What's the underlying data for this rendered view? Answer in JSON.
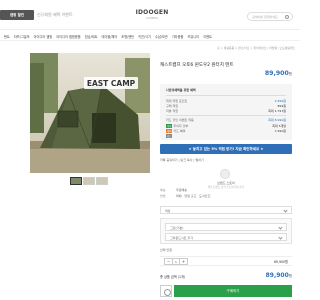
{
  "header": {
    "badge_text": "캠핑 할인",
    "promo_text": "신규회원 혜택 이벤트",
    "brand": "IDOOGEN",
    "brand_sub": "CAMPING",
    "search_placeholder": "검색어를 입력하세요"
  },
  "nav": {
    "items": [
      "텐트",
      "타프/그늘막",
      "아이디어 캠핑",
      "아이디어 캠핑용품",
      "침낭/매트",
      "테이블/체어",
      "조명/랜턴",
      "키친/식기",
      "수납/보관",
      "기타용품",
      "커뮤니티",
      "이벤트"
    ]
  },
  "breadcrumb": "홈  >  캠핑용품  >  텐트/타프  >  원터치텐트 / 리빙쉘 / 오토캠핑텐트",
  "product": {
    "image_label": "EAST CAMP",
    "title": "캐스트캠프 오토6 윈도우2 원터치 텐트",
    "price": "89,900",
    "price_unit": "원"
  },
  "benefits": {
    "heading": "나만의혜택을 위한 혜택",
    "rows": [
      {
        "label": "최대 적립 포인트",
        "value": "2,696원"
      },
      {
        "label": "구매 적립",
        "value": "899원"
      },
      {
        "label": "리뷰 적립",
        "value": "최대 1,797원"
      },
      {
        "label": "카드 할인 이벤트 적용",
        "value": "최대 8,990원"
      },
      {
        "label": "무이자 할부",
        "value": "최대 5개월"
      },
      {
        "label": "카드 혜택",
        "value": "7,990원"
      }
    ],
    "tags": [
      "추가",
      "혜택",
      "카드"
    ]
  },
  "banner": "★ 놓치고 있는 5% 적립 받기! 지금 확인하세요 ★",
  "share": "카톡 공유하기  |  링크 복사  |  찜하기",
  "seller": {
    "title": "브랜드 스토어",
    "subtitle": "캐스트캠프 공식 스토어 바로가기"
  },
  "shipping": {
    "rows": [
      {
        "label": "배송",
        "value": "무료배송"
      },
      {
        "label": "방법",
        "value": "택배 · 당일 출고 · 도서산간"
      }
    ]
  },
  "options": {
    "select1": "색상",
    "select2": "그린(기본)",
    "select3": "그라운드시트 추가",
    "select4": "선택 안함"
  },
  "quantity": {
    "value": "1",
    "minus": "−",
    "plus": "+",
    "price": "89,900원"
  },
  "total": {
    "label": "총 상품 금액",
    "count": "(1개)",
    "value": "89,900",
    "unit": "원"
  },
  "buttons": {
    "buy": "구매하기"
  },
  "colors": {
    "accent_blue": "#2f6fb8",
    "buy_green": "#2aa04a"
  }
}
